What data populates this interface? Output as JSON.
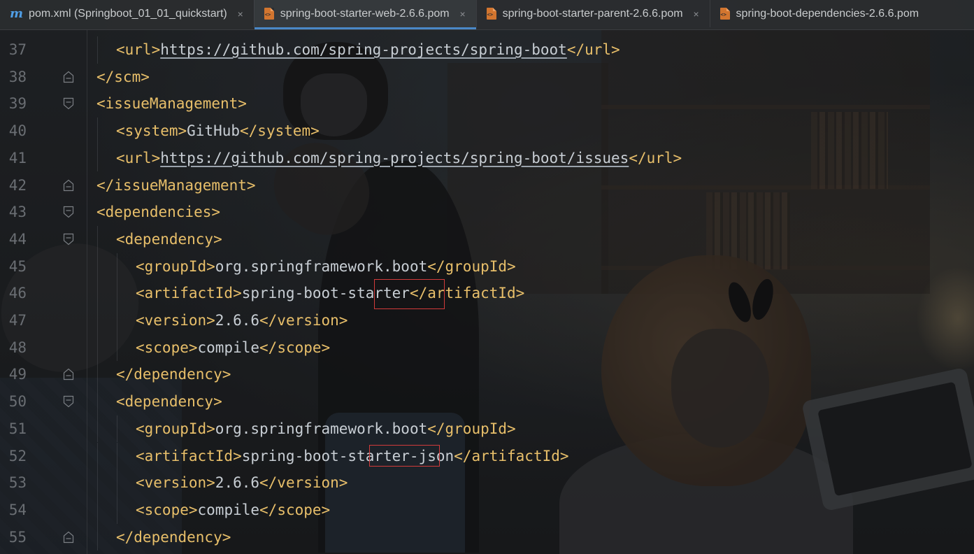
{
  "tabs": [
    {
      "label": "pom.xml (Springboot_01_01_quickstart)",
      "icon": "maven-m-icon",
      "active": false,
      "closable": true
    },
    {
      "label": "spring-boot-starter-web-2.6.6.pom",
      "icon": "xml-file-icon",
      "active": true,
      "closable": true
    },
    {
      "label": "spring-boot-starter-parent-2.6.6.pom",
      "icon": "xml-file-icon",
      "active": false,
      "closable": true
    },
    {
      "label": "spring-boot-dependencies-2.6.6.pom",
      "icon": "xml-file-icon",
      "active": false,
      "closable": false
    }
  ],
  "tab_close_glyph": "×",
  "lines": {
    "l37": {
      "num": "37",
      "open": "<url>",
      "text": "https://github.com/spring-projects/spring-boot",
      "close": "</url>"
    },
    "l38": {
      "num": "38",
      "tag": "</scm>"
    },
    "l39": {
      "num": "39",
      "tag": "<issueManagement>"
    },
    "l40": {
      "num": "40",
      "open": "<system>",
      "text": "GitHub",
      "close": "</system>"
    },
    "l41": {
      "num": "41",
      "open": "<url>",
      "text": "https://github.com/spring-projects/spring-boot/issues",
      "close": "</url>"
    },
    "l42": {
      "num": "42",
      "tag": "</issueManagement>"
    },
    "l43": {
      "num": "43",
      "tag": "<dependencies>"
    },
    "l44": {
      "num": "44",
      "tag": "<dependency>"
    },
    "l45": {
      "num": "45",
      "open": "<groupId>",
      "text": "org.springframework.boot",
      "close": "</groupId>"
    },
    "l46": {
      "num": "46",
      "open": "<artifactId>",
      "text": "spring-boot-starter",
      "close": "</artifactId>"
    },
    "l47": {
      "num": "47",
      "open": "<version>",
      "text": "2.6.6",
      "close": "</version>"
    },
    "l48": {
      "num": "48",
      "open": "<scope>",
      "text": "compile",
      "close": "</scope>"
    },
    "l49": {
      "num": "49",
      "tag": "</dependency>"
    },
    "l50": {
      "num": "50",
      "tag": "<dependency>"
    },
    "l51": {
      "num": "51",
      "open": "<groupId>",
      "text": "org.springframework.boot",
      "close": "</groupId>"
    },
    "l52": {
      "num": "52",
      "open": "<artifactId>",
      "text": "spring-boot-starter-json",
      "close": "</artifactId>"
    },
    "l53": {
      "num": "53",
      "open": "<version>",
      "text": "2.6.6",
      "close": "</version>"
    },
    "l54": {
      "num": "54",
      "open": "<scope>",
      "text": "compile",
      "close": "</scope>"
    },
    "l55": {
      "num": "55",
      "tag": "</dependency>"
    }
  },
  "colors": {
    "tag": "#e8bf6a",
    "text": "#c8ced4",
    "line_number": "#6a6e73",
    "highlight_box": "#d23b3b",
    "active_tab_underline": "#4a88c7",
    "maven_icon": "#4f9ee6",
    "xml_icon": "#d2752f"
  }
}
